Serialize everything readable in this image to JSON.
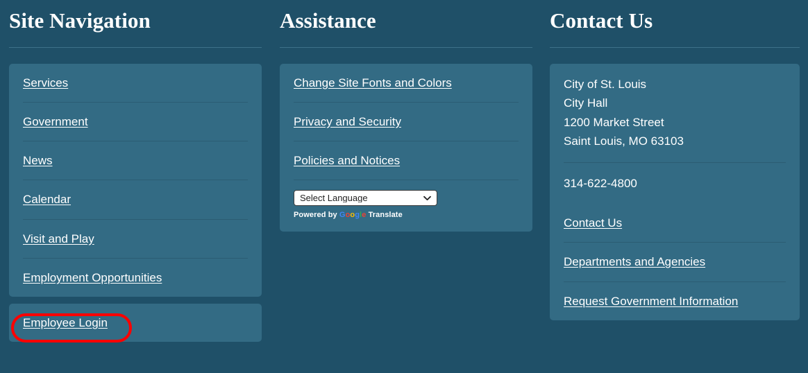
{
  "theme": {
    "page_background": "#1f5068",
    "panel_background": "#336b84",
    "divider": "#2b5d73",
    "heading_rule": "#3d7189",
    "text": "#ffffff",
    "highlight_outline": "#ff0000"
  },
  "columns": {
    "site_navigation": {
      "heading": "Site Navigation",
      "links": [
        {
          "label": "Services"
        },
        {
          "label": "Government"
        },
        {
          "label": "News"
        },
        {
          "label": "Calendar"
        },
        {
          "label": "Visit and Play"
        },
        {
          "label": "Employment Opportunities"
        }
      ],
      "secondary_links": [
        {
          "label": "Employee Login",
          "highlighted": true
        }
      ]
    },
    "assistance": {
      "heading": "Assistance",
      "links": [
        {
          "label": "Change Site Fonts and Colors"
        },
        {
          "label": "Privacy and Security"
        },
        {
          "label": "Policies and Notices"
        }
      ],
      "translate": {
        "select_value": "Select Language",
        "select_options": [
          "Select Language"
        ],
        "chevron_icon": "chevron-down-icon",
        "powered_by_prefix": "Powered by",
        "google_letters": [
          {
            "char": "G",
            "color": "#4285F4"
          },
          {
            "char": "o",
            "color": "#EA4335"
          },
          {
            "char": "o",
            "color": "#FBBC05"
          },
          {
            "char": "g",
            "color": "#4285F4"
          },
          {
            "char": "l",
            "color": "#34A853"
          },
          {
            "char": "e",
            "color": "#EA4335"
          }
        ],
        "powered_by_suffix": "Translate"
      }
    },
    "contact_us": {
      "heading": "Contact Us",
      "address": [
        "City of St. Louis",
        "City Hall",
        "1200 Market Street",
        "Saint Louis, MO 63103"
      ],
      "phone": "314-622-4800",
      "links": [
        {
          "label": "Contact Us"
        },
        {
          "label": "Departments and Agencies"
        },
        {
          "label": "Request Government Information"
        }
      ]
    }
  }
}
